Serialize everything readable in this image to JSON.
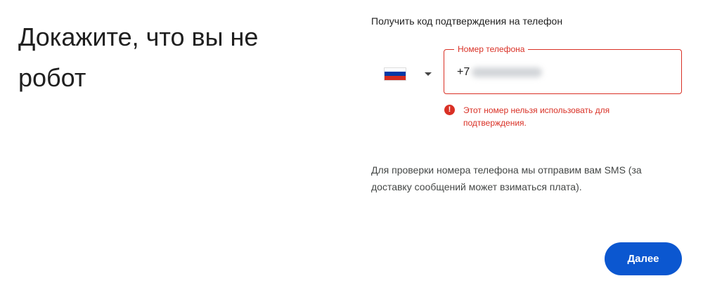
{
  "page": {
    "title": "Докажите, что вы не робот"
  },
  "form": {
    "subtitle": "Получить код подтверждения на телефон",
    "country": {
      "flag_colors": [
        "#ffffff",
        "#0039a6",
        "#d52b1e"
      ]
    },
    "phone": {
      "label": "Номер телефона",
      "prefix": "+7"
    },
    "error": "Этот номер нельзя использовать для подтверждения.",
    "info": "Для проверки номера телефона мы отправим вам SMS (за доставку сообщений может взиматься плата)."
  },
  "actions": {
    "next_label": "Далее"
  },
  "colors": {
    "error": "#d93025",
    "primary": "#0b57d0"
  }
}
